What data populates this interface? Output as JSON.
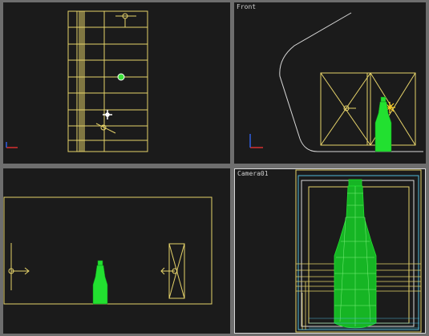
{
  "viewports": {
    "top": {
      "label": ""
    },
    "front": {
      "label": "Front"
    },
    "left": {
      "label": ""
    },
    "camera": {
      "label": "Camera01"
    }
  },
  "colors": {
    "background": "#1b1b1b",
    "border": "#6e6e6e",
    "wire_yellow": "#e6d36a",
    "bottle_green": "#22e030",
    "frame_cyan": "#4fb8d8",
    "frame_white": "#d8d8d8",
    "axis_red": "#d63030",
    "axis_blue": "#3060e0",
    "selected_green": "#3ce13c"
  },
  "icons": [
    "camera-icon",
    "light-icon",
    "axis-gizmo-icon",
    "move-cursor-icon"
  ]
}
